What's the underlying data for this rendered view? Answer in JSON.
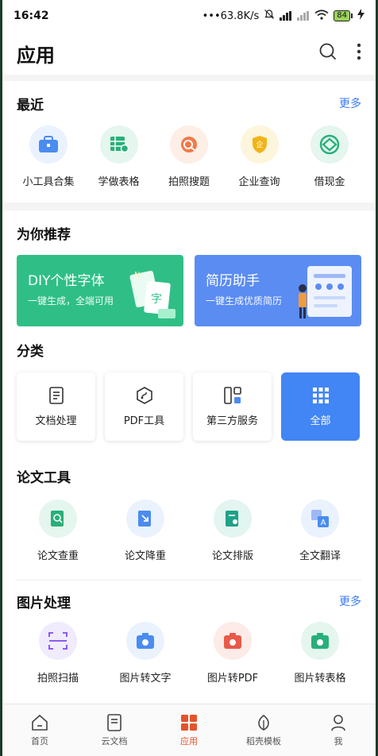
{
  "status_bar": {
    "time": "16:42",
    "network_speed": "•••63.8K/s",
    "battery": "84"
  },
  "header": {
    "title": "应用"
  },
  "recent": {
    "heading": "最近",
    "more": "更多",
    "items": [
      {
        "label": "小工具合集",
        "icon": "toolbox-icon",
        "color": "#4a8cf0"
      },
      {
        "label": "学做表格",
        "icon": "table-icon",
        "color": "#27b07a"
      },
      {
        "label": "拍照搜题",
        "icon": "camera-search-icon",
        "color": "#f07a4a"
      },
      {
        "label": "企业查询",
        "icon": "shield-icon",
        "color": "#f2b318"
      },
      {
        "label": "借现金",
        "icon": "cash-icon",
        "color": "#27b07a"
      }
    ]
  },
  "recommend": {
    "heading": "为你推荐",
    "banners": [
      {
        "title": "DIY个性字体",
        "subtitle": "一键生成，全端可用",
        "color": "#2fbf86"
      },
      {
        "title": "简历助手",
        "subtitle": "一键生成优质简历",
        "color": "#5b8cf2"
      }
    ]
  },
  "category": {
    "heading": "分类",
    "items": [
      {
        "label": "文档处理",
        "icon": "document-icon"
      },
      {
        "label": "PDF工具",
        "icon": "pdf-icon"
      },
      {
        "label": "第三方服务",
        "icon": "grid-layout-icon"
      },
      {
        "label": "全部",
        "icon": "all-apps-icon"
      }
    ]
  },
  "thesis": {
    "heading": "论文工具",
    "items": [
      {
        "label": "论文查重",
        "icon": "thesis-check-icon",
        "color": "#27b07a"
      },
      {
        "label": "论文降重",
        "icon": "thesis-reduce-icon",
        "color": "#4a8cf0"
      },
      {
        "label": "论文排版",
        "icon": "thesis-format-icon",
        "color": "#1fa28a"
      },
      {
        "label": "全文翻译",
        "icon": "translate-icon",
        "color": "#4a8cf0"
      }
    ]
  },
  "image": {
    "heading": "图片处理",
    "more": "更多",
    "items": [
      {
        "label": "拍照扫描",
        "icon": "scan-icon",
        "color": "#8a5cf0"
      },
      {
        "label": "图片转文字",
        "icon": "image-to-text-icon",
        "color": "#4a8cf0"
      },
      {
        "label": "图片转PDF",
        "icon": "image-to-pdf-icon",
        "color": "#e85a4a"
      },
      {
        "label": "图片转表格",
        "icon": "image-to-table-icon",
        "color": "#27b07a"
      }
    ]
  },
  "tabbar": {
    "items": [
      {
        "label": "首页",
        "icon": "home-icon"
      },
      {
        "label": "云文档",
        "icon": "cloud-doc-icon"
      },
      {
        "label": "应用",
        "icon": "apps-icon",
        "active": true
      },
      {
        "label": "稻壳模板",
        "icon": "leaf-icon"
      },
      {
        "label": "我",
        "icon": "profile-icon"
      }
    ]
  }
}
